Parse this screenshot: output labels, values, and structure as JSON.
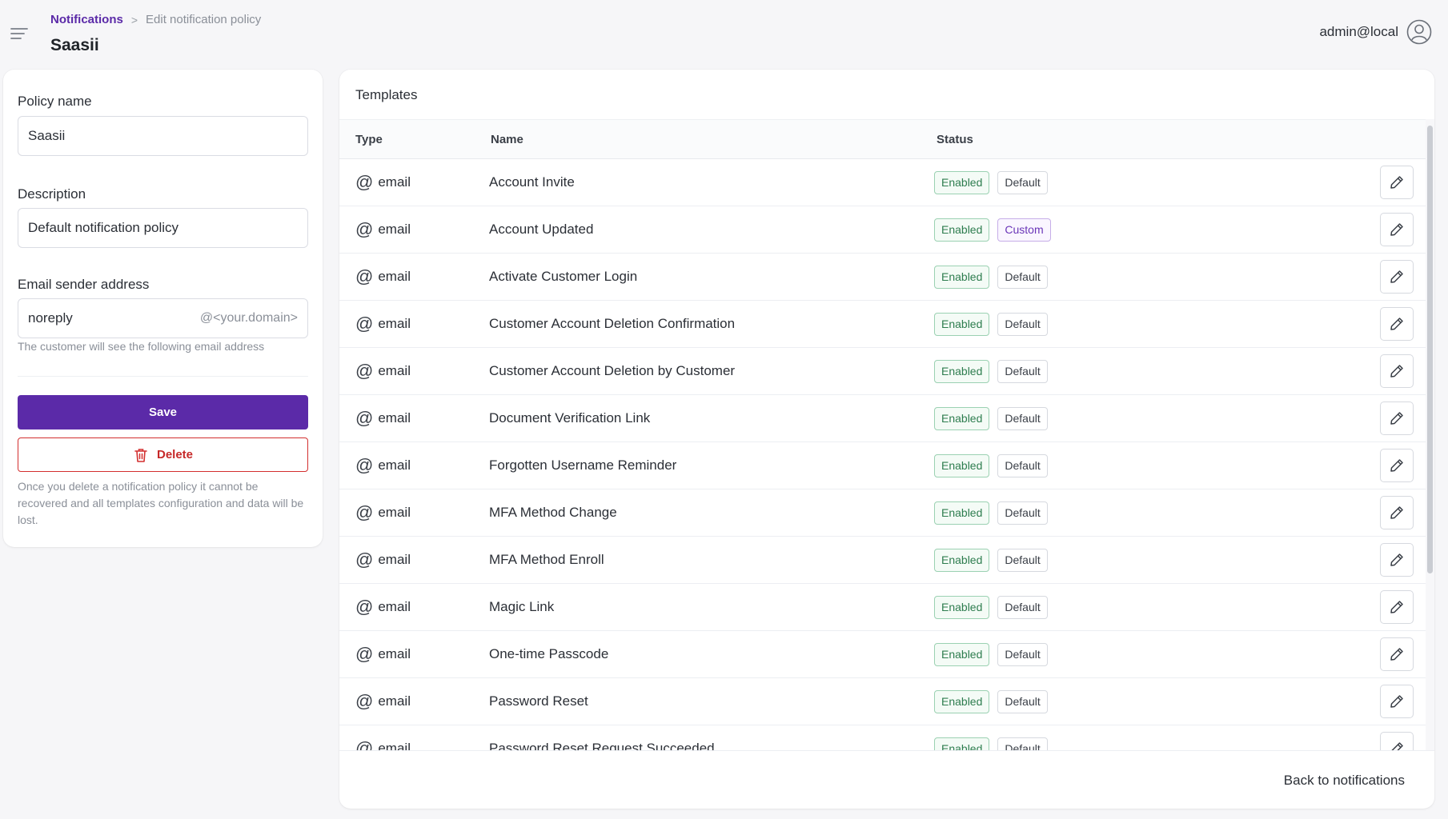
{
  "breadcrumb": {
    "parent": "Notifications",
    "separator": ">",
    "current": "Edit notification policy"
  },
  "page_title": "Saasii",
  "user": {
    "name": "admin@local"
  },
  "form": {
    "policy_name_label": "Policy name",
    "policy_name_value": "Saasii",
    "description_label": "Description",
    "description_value": "Default notification policy",
    "sender_label": "Email sender address",
    "sender_value": "noreply",
    "sender_suffix": "@<your.domain>",
    "sender_hint": "The customer will see the following email address",
    "save_label": "Save",
    "delete_label": "Delete",
    "delete_warning": "Once you delete a notification policy it cannot be recovered and all templates configuration and data will be lost."
  },
  "templates": {
    "title": "Templates",
    "columns": {
      "type": "Type",
      "name": "Name",
      "status": "Status"
    },
    "rows": [
      {
        "type": "email",
        "name": "Account Invite",
        "enabled": "Enabled",
        "source": "Default"
      },
      {
        "type": "email",
        "name": "Account Updated",
        "enabled": "Enabled",
        "source": "Custom"
      },
      {
        "type": "email",
        "name": "Activate Customer Login",
        "enabled": "Enabled",
        "source": "Default"
      },
      {
        "type": "email",
        "name": "Customer Account Deletion Confirmation",
        "enabled": "Enabled",
        "source": "Default"
      },
      {
        "type": "email",
        "name": "Customer Account Deletion by Customer",
        "enabled": "Enabled",
        "source": "Default"
      },
      {
        "type": "email",
        "name": "Document Verification Link",
        "enabled": "Enabled",
        "source": "Default"
      },
      {
        "type": "email",
        "name": "Forgotten Username Reminder",
        "enabled": "Enabled",
        "source": "Default"
      },
      {
        "type": "email",
        "name": "MFA Method Change",
        "enabled": "Enabled",
        "source": "Default"
      },
      {
        "type": "email",
        "name": "MFA Method Enroll",
        "enabled": "Enabled",
        "source": "Default"
      },
      {
        "type": "email",
        "name": "Magic Link",
        "enabled": "Enabled",
        "source": "Default"
      },
      {
        "type": "email",
        "name": "One-time Passcode",
        "enabled": "Enabled",
        "source": "Default"
      },
      {
        "type": "email",
        "name": "Password Reset",
        "enabled": "Enabled",
        "source": "Default"
      },
      {
        "type": "email",
        "name": "Password Reset Request Succeeded",
        "enabled": "Enabled",
        "source": "Default"
      }
    ],
    "back_label": "Back to notifications"
  },
  "colors": {
    "primary": "#5b2aa8",
    "danger": "#d32f2f",
    "enabled": "#2e7d4f",
    "custom": "#6a35b8"
  },
  "icons": {
    "menu": "hamburger-icon",
    "user": "user-circle-icon",
    "delete": "trash-icon",
    "type": "at-sign-icon",
    "edit": "pencil-icon",
    "separator": "chevron-right-icon"
  }
}
